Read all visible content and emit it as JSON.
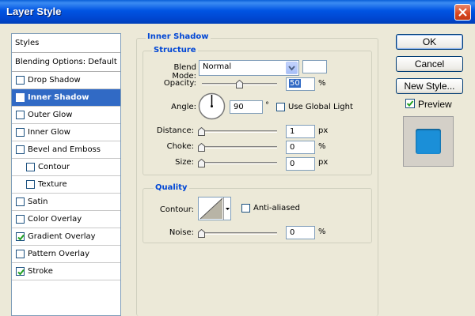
{
  "window": {
    "title": "Layer Style"
  },
  "list": {
    "header": "Styles",
    "blending": "Blending Options: Default",
    "items": [
      {
        "label": "Drop Shadow",
        "checked": false,
        "indent": false,
        "selected": false
      },
      {
        "label": "Inner Shadow",
        "checked": true,
        "indent": false,
        "selected": true
      },
      {
        "label": "Outer Glow",
        "checked": false,
        "indent": false,
        "selected": false
      },
      {
        "label": "Inner Glow",
        "checked": false,
        "indent": false,
        "selected": false
      },
      {
        "label": "Bevel and Emboss",
        "checked": false,
        "indent": false,
        "selected": false
      },
      {
        "label": "Contour",
        "checked": false,
        "indent": true,
        "selected": false
      },
      {
        "label": "Texture",
        "checked": false,
        "indent": true,
        "selected": false
      },
      {
        "label": "Satin",
        "checked": false,
        "indent": false,
        "selected": false
      },
      {
        "label": "Color Overlay",
        "checked": false,
        "indent": false,
        "selected": false
      },
      {
        "label": "Gradient Overlay",
        "checked": true,
        "indent": false,
        "selected": false
      },
      {
        "label": "Pattern Overlay",
        "checked": false,
        "indent": false,
        "selected": false
      },
      {
        "label": "Stroke",
        "checked": true,
        "indent": false,
        "selected": false
      }
    ]
  },
  "panel": {
    "section_title": "Inner Shadow",
    "structure_title": "Structure",
    "blend_mode_label": "Blend Mode:",
    "blend_mode_value": "Normal",
    "opacity_label": "Opacity:",
    "opacity_value": "50",
    "opacity_unit": "%",
    "opacity_level": 0.5,
    "angle_label": "Angle:",
    "angle_value": "90",
    "angle_unit": "°",
    "global_light_label": "Use Global Light",
    "distance_label": "Distance:",
    "distance_value": "1",
    "distance_unit": "px",
    "choke_label": "Choke:",
    "choke_value": "0",
    "choke_unit": "%",
    "size_label": "Size:",
    "size_value": "0",
    "size_unit": "px",
    "quality_title": "Quality",
    "contour_label": "Contour:",
    "anti_aliased_label": "Anti-aliased",
    "noise_label": "Noise:",
    "noise_value": "0",
    "noise_unit": "%"
  },
  "buttons": {
    "ok": "OK",
    "cancel": "Cancel",
    "new_style": "New Style...",
    "preview": "Preview"
  },
  "colors": {
    "accent": "#0046d5",
    "selection": "#316ac5",
    "preview_fill": "#1b8fd8"
  }
}
